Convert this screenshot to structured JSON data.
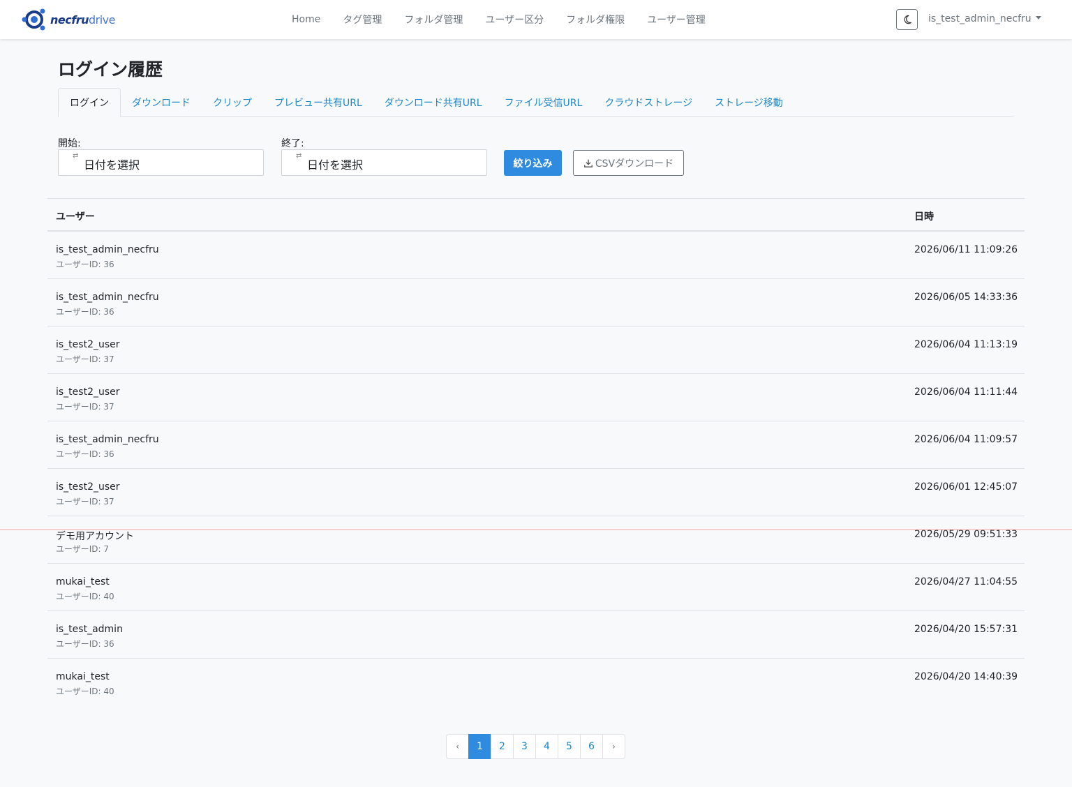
{
  "brand": {
    "name_bold": "necfru",
    "name_light": "drive"
  },
  "nav": {
    "links": [
      "Home",
      "タグ管理",
      "フォルダ管理",
      "ユーザー区分",
      "フォルダ権限",
      "ユーザー管理"
    ],
    "user": "is_test_admin_necfru"
  },
  "page": {
    "title": "ログイン履歴"
  },
  "tabs": [
    "ログイン",
    "ダウンロード",
    "クリップ",
    "プレビュー共有URL",
    "ダウンロード共有URL",
    "ファイル受信URL",
    "クラウドストレージ",
    "ストレージ移動"
  ],
  "filters": {
    "start_label": "開始:",
    "end_label": "終了:",
    "start_placeholder": "日付を選択",
    "end_placeholder": "日付を選択",
    "filter_button": "絞り込み",
    "csv_button": "CSVダウンロード"
  },
  "table": {
    "headers": {
      "user": "ユーザー",
      "datetime": "日時"
    },
    "rows": [
      {
        "user": "is_test_admin_necfru",
        "id": "ユーザーID: 36",
        "datetime": "2026/06/11 11:09:26"
      },
      {
        "user": "is_test_admin_necfru",
        "id": "ユーザーID: 36",
        "datetime": "2026/06/05 14:33:36"
      },
      {
        "user": "is_test2_user",
        "id": "ユーザーID: 37",
        "datetime": "2026/06/04 11:13:19"
      },
      {
        "user": "is_test2_user",
        "id": "ユーザーID: 37",
        "datetime": "2026/06/04 11:11:44"
      },
      {
        "user": "is_test_admin_necfru",
        "id": "ユーザーID: 36",
        "datetime": "2026/06/04 11:09:57"
      },
      {
        "user": "is_test2_user",
        "id": "ユーザーID: 37",
        "datetime": "2026/06/01 12:45:07"
      },
      {
        "user": "デモ用アカウント",
        "id": "ユーザーID: 7",
        "datetime": "2026/05/29 09:51:33"
      },
      {
        "user": "mukai_test",
        "id": "ユーザーID: 40",
        "datetime": "2026/04/27 11:04:55"
      },
      {
        "user": "is_test_admin",
        "id": "ユーザーID: 36",
        "datetime": "2026/04/20 15:57:31"
      },
      {
        "user": "mukai_test",
        "id": "ユーザーID: 40",
        "datetime": "2026/04/20 14:40:39"
      }
    ]
  },
  "pagination": {
    "prev": "‹",
    "next": "›",
    "pages": [
      "1",
      "2",
      "3",
      "4",
      "5",
      "6"
    ],
    "current": "1"
  },
  "colors": {
    "accent": "#2f8be0",
    "link": "#1e88c8",
    "brand_dark": "#1a3a8a"
  }
}
